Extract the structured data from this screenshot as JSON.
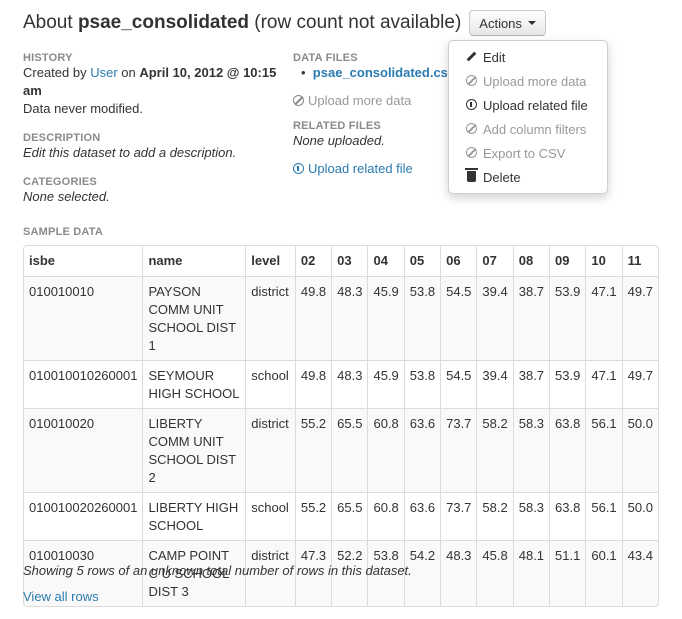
{
  "header": {
    "title_prefix": "About ",
    "dataset_name": "psae_consolidated",
    "title_suffix": " (row count not available)",
    "actions_label": "Actions"
  },
  "history": {
    "label": "History",
    "created_by": "Created by ",
    "user": "User",
    "on": " on ",
    "date": "April 10, 2012 @ 10:15 am",
    "modified": "Data never modified."
  },
  "description": {
    "label": "Description",
    "text": "Edit this dataset to add a description."
  },
  "categories": {
    "label": "Categories",
    "text": "None selected."
  },
  "data_files": {
    "label": "Data files",
    "file": "psae_consolidated.csv",
    "upload_more": "Upload more data"
  },
  "related_files": {
    "label": "Related files",
    "text": "None uploaded.",
    "upload": "Upload related file"
  },
  "actions_menu": [
    {
      "label": "Edit",
      "icon": "pencil-icon",
      "enabled": true
    },
    {
      "label": "Upload more data",
      "icon": "ban-icon",
      "enabled": false
    },
    {
      "label": "Upload related file",
      "icon": "upload-icon",
      "enabled": true
    },
    {
      "label": "Add column filters",
      "icon": "ban-icon",
      "enabled": false
    },
    {
      "label": "Export to CSV",
      "icon": "ban-icon",
      "enabled": false
    },
    {
      "label": "Delete",
      "icon": "trash-icon",
      "enabled": true
    }
  ],
  "sample": {
    "label": "Sample data",
    "columns": [
      "isbe",
      "name",
      "level",
      "02",
      "03",
      "04",
      "05",
      "06",
      "07",
      "08",
      "09",
      "10",
      "11"
    ],
    "rows": [
      [
        "010010010",
        "PAYSON COMM UNIT SCHOOL DIST 1",
        "district",
        "49.8",
        "48.3",
        "45.9",
        "53.8",
        "54.5",
        "39.4",
        "38.7",
        "53.9",
        "47.1",
        "49.7"
      ],
      [
        "010010010260001",
        "SEYMOUR HIGH SCHOOL",
        "school",
        "49.8",
        "48.3",
        "45.9",
        "53.8",
        "54.5",
        "39.4",
        "38.7",
        "53.9",
        "47.1",
        "49.7"
      ],
      [
        "010010020",
        "LIBERTY COMM UNIT SCHOOL DIST 2",
        "district",
        "55.2",
        "65.5",
        "60.8",
        "63.6",
        "73.7",
        "58.2",
        "58.3",
        "63.8",
        "56.1",
        "50.0"
      ],
      [
        "010010020260001",
        "LIBERTY HIGH SCHOOL",
        "school",
        "55.2",
        "65.5",
        "60.8",
        "63.6",
        "73.7",
        "58.2",
        "58.3",
        "63.8",
        "56.1",
        "50.0"
      ],
      [
        "010010030",
        "CAMP POINT C U SCHOOL DIST 3",
        "district",
        "47.3",
        "52.2",
        "53.8",
        "54.2",
        "48.3",
        "45.8",
        "48.1",
        "51.1",
        "60.1",
        "43.4"
      ]
    ],
    "footer": "Showing 5 rows of an unknown total number of rows in this dataset.",
    "view_all": "View all rows"
  }
}
